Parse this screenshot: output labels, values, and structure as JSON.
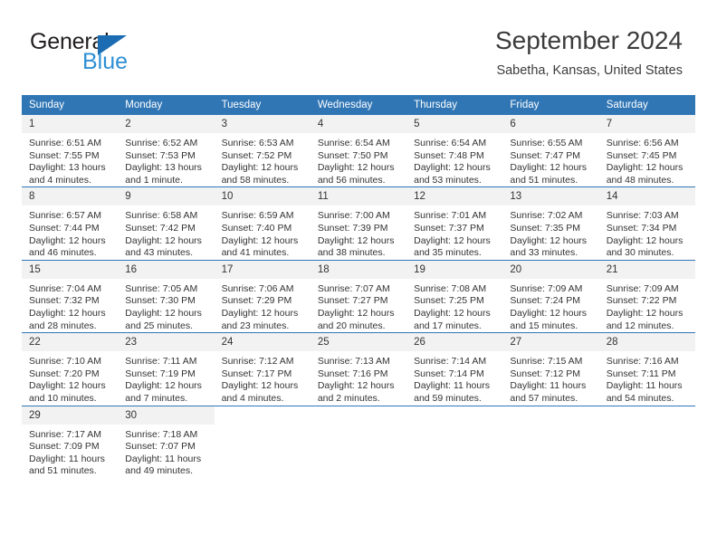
{
  "brand": {
    "name_part1": "General",
    "name_part2": "Blue",
    "accent_color": "#1b6cb3",
    "accent_color_light": "#2e8fd4"
  },
  "header": {
    "title": "September 2024",
    "subtitle": "Sabetha, Kansas, United States"
  },
  "theme": {
    "header_row_color": "#3076b5",
    "daynum_band_color": "#f2f2f2",
    "text_color": "#333333"
  },
  "weekday_headers": [
    "Sunday",
    "Monday",
    "Tuesday",
    "Wednesday",
    "Thursday",
    "Friday",
    "Saturday"
  ],
  "weeks": [
    [
      {
        "day": "1",
        "sunrise": "Sunrise: 6:51 AM",
        "sunset": "Sunset: 7:55 PM",
        "daylight": "Daylight: 13 hours and 4 minutes."
      },
      {
        "day": "2",
        "sunrise": "Sunrise: 6:52 AM",
        "sunset": "Sunset: 7:53 PM",
        "daylight": "Daylight: 13 hours and 1 minute."
      },
      {
        "day": "3",
        "sunrise": "Sunrise: 6:53 AM",
        "sunset": "Sunset: 7:52 PM",
        "daylight": "Daylight: 12 hours and 58 minutes."
      },
      {
        "day": "4",
        "sunrise": "Sunrise: 6:54 AM",
        "sunset": "Sunset: 7:50 PM",
        "daylight": "Daylight: 12 hours and 56 minutes."
      },
      {
        "day": "5",
        "sunrise": "Sunrise: 6:54 AM",
        "sunset": "Sunset: 7:48 PM",
        "daylight": "Daylight: 12 hours and 53 minutes."
      },
      {
        "day": "6",
        "sunrise": "Sunrise: 6:55 AM",
        "sunset": "Sunset: 7:47 PM",
        "daylight": "Daylight: 12 hours and 51 minutes."
      },
      {
        "day": "7",
        "sunrise": "Sunrise: 6:56 AM",
        "sunset": "Sunset: 7:45 PM",
        "daylight": "Daylight: 12 hours and 48 minutes."
      }
    ],
    [
      {
        "day": "8",
        "sunrise": "Sunrise: 6:57 AM",
        "sunset": "Sunset: 7:44 PM",
        "daylight": "Daylight: 12 hours and 46 minutes."
      },
      {
        "day": "9",
        "sunrise": "Sunrise: 6:58 AM",
        "sunset": "Sunset: 7:42 PM",
        "daylight": "Daylight: 12 hours and 43 minutes."
      },
      {
        "day": "10",
        "sunrise": "Sunrise: 6:59 AM",
        "sunset": "Sunset: 7:40 PM",
        "daylight": "Daylight: 12 hours and 41 minutes."
      },
      {
        "day": "11",
        "sunrise": "Sunrise: 7:00 AM",
        "sunset": "Sunset: 7:39 PM",
        "daylight": "Daylight: 12 hours and 38 minutes."
      },
      {
        "day": "12",
        "sunrise": "Sunrise: 7:01 AM",
        "sunset": "Sunset: 7:37 PM",
        "daylight": "Daylight: 12 hours and 35 minutes."
      },
      {
        "day": "13",
        "sunrise": "Sunrise: 7:02 AM",
        "sunset": "Sunset: 7:35 PM",
        "daylight": "Daylight: 12 hours and 33 minutes."
      },
      {
        "day": "14",
        "sunrise": "Sunrise: 7:03 AM",
        "sunset": "Sunset: 7:34 PM",
        "daylight": "Daylight: 12 hours and 30 minutes."
      }
    ],
    [
      {
        "day": "15",
        "sunrise": "Sunrise: 7:04 AM",
        "sunset": "Sunset: 7:32 PM",
        "daylight": "Daylight: 12 hours and 28 minutes."
      },
      {
        "day": "16",
        "sunrise": "Sunrise: 7:05 AM",
        "sunset": "Sunset: 7:30 PM",
        "daylight": "Daylight: 12 hours and 25 minutes."
      },
      {
        "day": "17",
        "sunrise": "Sunrise: 7:06 AM",
        "sunset": "Sunset: 7:29 PM",
        "daylight": "Daylight: 12 hours and 23 minutes."
      },
      {
        "day": "18",
        "sunrise": "Sunrise: 7:07 AM",
        "sunset": "Sunset: 7:27 PM",
        "daylight": "Daylight: 12 hours and 20 minutes."
      },
      {
        "day": "19",
        "sunrise": "Sunrise: 7:08 AM",
        "sunset": "Sunset: 7:25 PM",
        "daylight": "Daylight: 12 hours and 17 minutes."
      },
      {
        "day": "20",
        "sunrise": "Sunrise: 7:09 AM",
        "sunset": "Sunset: 7:24 PM",
        "daylight": "Daylight: 12 hours and 15 minutes."
      },
      {
        "day": "21",
        "sunrise": "Sunrise: 7:09 AM",
        "sunset": "Sunset: 7:22 PM",
        "daylight": "Daylight: 12 hours and 12 minutes."
      }
    ],
    [
      {
        "day": "22",
        "sunrise": "Sunrise: 7:10 AM",
        "sunset": "Sunset: 7:20 PM",
        "daylight": "Daylight: 12 hours and 10 minutes."
      },
      {
        "day": "23",
        "sunrise": "Sunrise: 7:11 AM",
        "sunset": "Sunset: 7:19 PM",
        "daylight": "Daylight: 12 hours and 7 minutes."
      },
      {
        "day": "24",
        "sunrise": "Sunrise: 7:12 AM",
        "sunset": "Sunset: 7:17 PM",
        "daylight": "Daylight: 12 hours and 4 minutes."
      },
      {
        "day": "25",
        "sunrise": "Sunrise: 7:13 AM",
        "sunset": "Sunset: 7:16 PM",
        "daylight": "Daylight: 12 hours and 2 minutes."
      },
      {
        "day": "26",
        "sunrise": "Sunrise: 7:14 AM",
        "sunset": "Sunset: 7:14 PM",
        "daylight": "Daylight: 11 hours and 59 minutes."
      },
      {
        "day": "27",
        "sunrise": "Sunrise: 7:15 AM",
        "sunset": "Sunset: 7:12 PM",
        "daylight": "Daylight: 11 hours and 57 minutes."
      },
      {
        "day": "28",
        "sunrise": "Sunrise: 7:16 AM",
        "sunset": "Sunset: 7:11 PM",
        "daylight": "Daylight: 11 hours and 54 minutes."
      }
    ],
    [
      {
        "day": "29",
        "sunrise": "Sunrise: 7:17 AM",
        "sunset": "Sunset: 7:09 PM",
        "daylight": "Daylight: 11 hours and 51 minutes."
      },
      {
        "day": "30",
        "sunrise": "Sunrise: 7:18 AM",
        "sunset": "Sunset: 7:07 PM",
        "daylight": "Daylight: 11 hours and 49 minutes."
      },
      {
        "day": "",
        "sunrise": "",
        "sunset": "",
        "daylight": ""
      },
      {
        "day": "",
        "sunrise": "",
        "sunset": "",
        "daylight": ""
      },
      {
        "day": "",
        "sunrise": "",
        "sunset": "",
        "daylight": ""
      },
      {
        "day": "",
        "sunrise": "",
        "sunset": "",
        "daylight": ""
      },
      {
        "day": "",
        "sunrise": "",
        "sunset": "",
        "daylight": ""
      }
    ]
  ]
}
